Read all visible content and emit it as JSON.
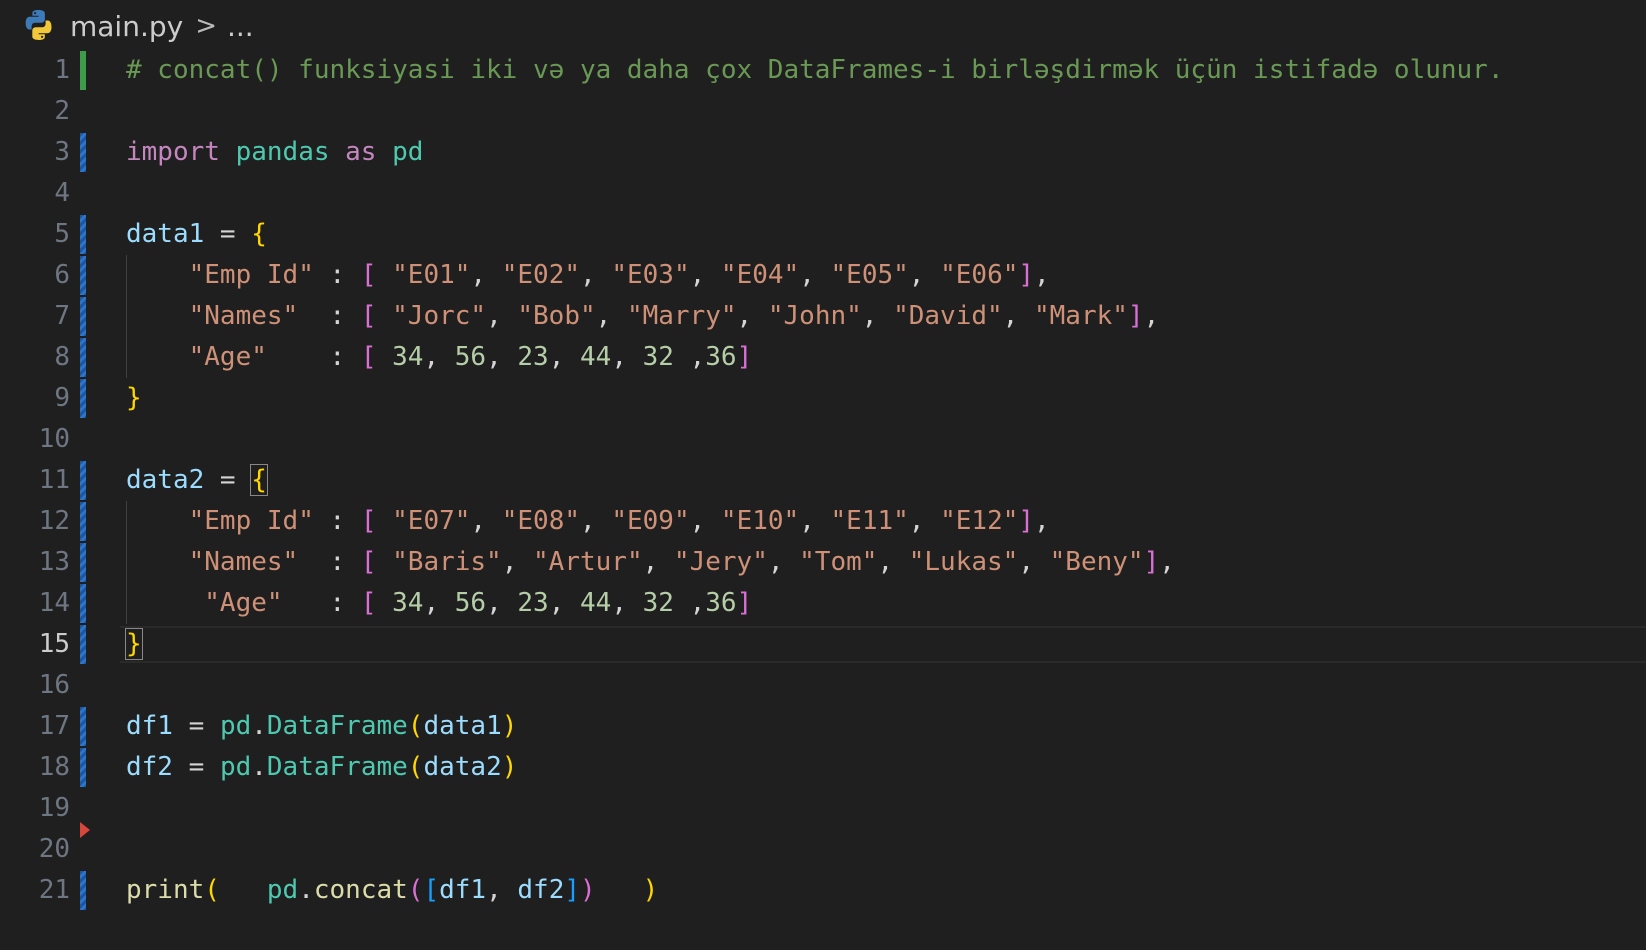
{
  "breadcrumb": {
    "file": "main.py",
    "separator": ">",
    "ellipsis": "..."
  },
  "editor": {
    "language": "python",
    "active_line": 15,
    "lines": [
      {
        "n": "1",
        "marker": "added",
        "tokens": [
          {
            "t": "# concat() funksiyasi iki və ya daha çox DataFrames-i birləşdirmək üçün istifadə olunur.",
            "c": "c-comment"
          }
        ]
      },
      {
        "n": "2",
        "marker": "",
        "tokens": []
      },
      {
        "n": "3",
        "marker": "modified",
        "tokens": [
          {
            "t": "import",
            "c": "c-kw"
          },
          {
            "t": " ",
            "c": ""
          },
          {
            "t": "pandas",
            "c": "c-mod"
          },
          {
            "t": " ",
            "c": ""
          },
          {
            "t": "as",
            "c": "c-kw"
          },
          {
            "t": " ",
            "c": ""
          },
          {
            "t": "pd",
            "c": "c-mod"
          }
        ]
      },
      {
        "n": "4",
        "marker": "",
        "tokens": []
      },
      {
        "n": "5",
        "marker": "modified",
        "tokens": [
          {
            "t": "data1",
            "c": "c-var"
          },
          {
            "t": " = ",
            "c": "c-op"
          },
          {
            "t": "{",
            "c": "c-brace"
          }
        ]
      },
      {
        "n": "6",
        "marker": "modified",
        "guide": true,
        "tokens": [
          {
            "t": "    ",
            "c": ""
          },
          {
            "t": "\"Emp Id\"",
            "c": "c-str"
          },
          {
            "t": " : ",
            "c": "c-op"
          },
          {
            "t": "[",
            "c": "c-bracket"
          },
          {
            "t": " ",
            "c": ""
          },
          {
            "t": "\"E01\"",
            "c": "c-str"
          },
          {
            "t": ", ",
            "c": "c-op"
          },
          {
            "t": "\"E02\"",
            "c": "c-str"
          },
          {
            "t": ", ",
            "c": "c-op"
          },
          {
            "t": "\"E03\"",
            "c": "c-str"
          },
          {
            "t": ", ",
            "c": "c-op"
          },
          {
            "t": "\"E04\"",
            "c": "c-str"
          },
          {
            "t": ", ",
            "c": "c-op"
          },
          {
            "t": "\"E05\"",
            "c": "c-str"
          },
          {
            "t": ", ",
            "c": "c-op"
          },
          {
            "t": "\"E06\"",
            "c": "c-str"
          },
          {
            "t": "]",
            "c": "c-bracket"
          },
          {
            "t": ",",
            "c": "c-op"
          }
        ]
      },
      {
        "n": "7",
        "marker": "modified",
        "guide": true,
        "tokens": [
          {
            "t": "    ",
            "c": ""
          },
          {
            "t": "\"Names\"",
            "c": "c-str"
          },
          {
            "t": "  : ",
            "c": "c-op"
          },
          {
            "t": "[",
            "c": "c-bracket"
          },
          {
            "t": " ",
            "c": ""
          },
          {
            "t": "\"Jorc\"",
            "c": "c-str"
          },
          {
            "t": ", ",
            "c": "c-op"
          },
          {
            "t": "\"Bob\"",
            "c": "c-str"
          },
          {
            "t": ", ",
            "c": "c-op"
          },
          {
            "t": "\"Marry\"",
            "c": "c-str"
          },
          {
            "t": ", ",
            "c": "c-op"
          },
          {
            "t": "\"John\"",
            "c": "c-str"
          },
          {
            "t": ", ",
            "c": "c-op"
          },
          {
            "t": "\"David\"",
            "c": "c-str"
          },
          {
            "t": ", ",
            "c": "c-op"
          },
          {
            "t": "\"Mark\"",
            "c": "c-str"
          },
          {
            "t": "]",
            "c": "c-bracket"
          },
          {
            "t": ",",
            "c": "c-op"
          }
        ]
      },
      {
        "n": "8",
        "marker": "modified",
        "guide": true,
        "tokens": [
          {
            "t": "    ",
            "c": ""
          },
          {
            "t": "\"Age\"",
            "c": "c-str"
          },
          {
            "t": "    : ",
            "c": "c-op"
          },
          {
            "t": "[",
            "c": "c-bracket"
          },
          {
            "t": " ",
            "c": ""
          },
          {
            "t": "34",
            "c": "c-num"
          },
          {
            "t": ", ",
            "c": "c-op"
          },
          {
            "t": "56",
            "c": "c-num"
          },
          {
            "t": ", ",
            "c": "c-op"
          },
          {
            "t": "23",
            "c": "c-num"
          },
          {
            "t": ", ",
            "c": "c-op"
          },
          {
            "t": "44",
            "c": "c-num"
          },
          {
            "t": ", ",
            "c": "c-op"
          },
          {
            "t": "32",
            "c": "c-num"
          },
          {
            "t": " ,",
            "c": "c-op"
          },
          {
            "t": "36",
            "c": "c-num"
          },
          {
            "t": "]",
            "c": "c-bracket"
          }
        ]
      },
      {
        "n": "9",
        "marker": "modified",
        "tokens": [
          {
            "t": "}",
            "c": "c-brace"
          }
        ]
      },
      {
        "n": "10",
        "marker": "",
        "tokens": []
      },
      {
        "n": "11",
        "marker": "modified",
        "tokens": [
          {
            "t": "data2",
            "c": "c-var"
          },
          {
            "t": " = ",
            "c": "c-op"
          },
          {
            "t": "{",
            "c": "c-brace bracket-match"
          }
        ]
      },
      {
        "n": "12",
        "marker": "modified",
        "guide": true,
        "tokens": [
          {
            "t": "    ",
            "c": ""
          },
          {
            "t": "\"Emp Id\"",
            "c": "c-str"
          },
          {
            "t": " : ",
            "c": "c-op"
          },
          {
            "t": "[",
            "c": "c-bracket"
          },
          {
            "t": " ",
            "c": ""
          },
          {
            "t": "\"E07\"",
            "c": "c-str"
          },
          {
            "t": ", ",
            "c": "c-op"
          },
          {
            "t": "\"E08\"",
            "c": "c-str"
          },
          {
            "t": ", ",
            "c": "c-op"
          },
          {
            "t": "\"E09\"",
            "c": "c-str"
          },
          {
            "t": ", ",
            "c": "c-op"
          },
          {
            "t": "\"E10\"",
            "c": "c-str"
          },
          {
            "t": ", ",
            "c": "c-op"
          },
          {
            "t": "\"E11\"",
            "c": "c-str"
          },
          {
            "t": ", ",
            "c": "c-op"
          },
          {
            "t": "\"E12\"",
            "c": "c-str"
          },
          {
            "t": "]",
            "c": "c-bracket"
          },
          {
            "t": ",",
            "c": "c-op"
          }
        ]
      },
      {
        "n": "13",
        "marker": "modified",
        "guide": true,
        "tokens": [
          {
            "t": "    ",
            "c": ""
          },
          {
            "t": "\"Names\"",
            "c": "c-str"
          },
          {
            "t": "  : ",
            "c": "c-op"
          },
          {
            "t": "[",
            "c": "c-bracket"
          },
          {
            "t": " ",
            "c": ""
          },
          {
            "t": "\"Baris\"",
            "c": "c-str"
          },
          {
            "t": ", ",
            "c": "c-op"
          },
          {
            "t": "\"Artur\"",
            "c": "c-str"
          },
          {
            "t": ", ",
            "c": "c-op"
          },
          {
            "t": "\"Jery\"",
            "c": "c-str"
          },
          {
            "t": ", ",
            "c": "c-op"
          },
          {
            "t": "\"Tom\"",
            "c": "c-str"
          },
          {
            "t": ", ",
            "c": "c-op"
          },
          {
            "t": "\"Lukas\"",
            "c": "c-str"
          },
          {
            "t": ", ",
            "c": "c-op"
          },
          {
            "t": "\"Beny\"",
            "c": "c-str"
          },
          {
            "t": "]",
            "c": "c-bracket"
          },
          {
            "t": ",",
            "c": "c-op"
          }
        ]
      },
      {
        "n": "14",
        "marker": "modified",
        "guide": true,
        "tokens": [
          {
            "t": "     ",
            "c": ""
          },
          {
            "t": "\"Age\"",
            "c": "c-str"
          },
          {
            "t": "   : ",
            "c": "c-op"
          },
          {
            "t": "[",
            "c": "c-bracket"
          },
          {
            "t": " ",
            "c": ""
          },
          {
            "t": "34",
            "c": "c-num"
          },
          {
            "t": ", ",
            "c": "c-op"
          },
          {
            "t": "56",
            "c": "c-num"
          },
          {
            "t": ", ",
            "c": "c-op"
          },
          {
            "t": "23",
            "c": "c-num"
          },
          {
            "t": ", ",
            "c": "c-op"
          },
          {
            "t": "44",
            "c": "c-num"
          },
          {
            "t": ", ",
            "c": "c-op"
          },
          {
            "t": "32",
            "c": "c-num"
          },
          {
            "t": " ,",
            "c": "c-op"
          },
          {
            "t": "36",
            "c": "c-num"
          },
          {
            "t": "]",
            "c": "c-bracket"
          }
        ]
      },
      {
        "n": "15",
        "marker": "modified",
        "tokens": [
          {
            "t": "}",
            "c": "c-brace bracket-match"
          }
        ]
      },
      {
        "n": "16",
        "marker": "",
        "tokens": []
      },
      {
        "n": "17",
        "marker": "modified",
        "tokens": [
          {
            "t": "df1",
            "c": "c-var"
          },
          {
            "t": " = ",
            "c": "c-op"
          },
          {
            "t": "pd",
            "c": "c-mod"
          },
          {
            "t": ".",
            "c": "c-op"
          },
          {
            "t": "DataFrame",
            "c": "c-mod"
          },
          {
            "t": "(",
            "c": "c-brace"
          },
          {
            "t": "data1",
            "c": "c-var"
          },
          {
            "t": ")",
            "c": "c-brace"
          }
        ]
      },
      {
        "n": "18",
        "marker": "modified",
        "tokens": [
          {
            "t": "df2",
            "c": "c-var"
          },
          {
            "t": " = ",
            "c": "c-op"
          },
          {
            "t": "pd",
            "c": "c-mod"
          },
          {
            "t": ".",
            "c": "c-op"
          },
          {
            "t": "DataFrame",
            "c": "c-mod"
          },
          {
            "t": "(",
            "c": "c-brace"
          },
          {
            "t": "data2",
            "c": "c-var"
          },
          {
            "t": ")",
            "c": "c-brace"
          }
        ]
      },
      {
        "n": "19",
        "marker": "deleted",
        "tokens": []
      },
      {
        "n": "20",
        "marker": "",
        "tokens": []
      },
      {
        "n": "21",
        "marker": "modified",
        "tokens": [
          {
            "t": "print",
            "c": "c-fn"
          },
          {
            "t": "(",
            "c": "c-brace"
          },
          {
            "t": "   ",
            "c": ""
          },
          {
            "t": "pd",
            "c": "c-mod"
          },
          {
            "t": ".",
            "c": "c-op"
          },
          {
            "t": "concat",
            "c": "c-fn"
          },
          {
            "t": "(",
            "c": "c-bracket"
          },
          {
            "t": "[",
            "c": "c-bracket2"
          },
          {
            "t": "df1",
            "c": "c-var"
          },
          {
            "t": ", ",
            "c": "c-op"
          },
          {
            "t": "df2",
            "c": "c-var"
          },
          {
            "t": "]",
            "c": "c-bracket2"
          },
          {
            "t": ")",
            "c": "c-bracket"
          },
          {
            "t": "   ",
            "c": ""
          },
          {
            "t": ")",
            "c": "c-brace"
          }
        ]
      }
    ]
  }
}
